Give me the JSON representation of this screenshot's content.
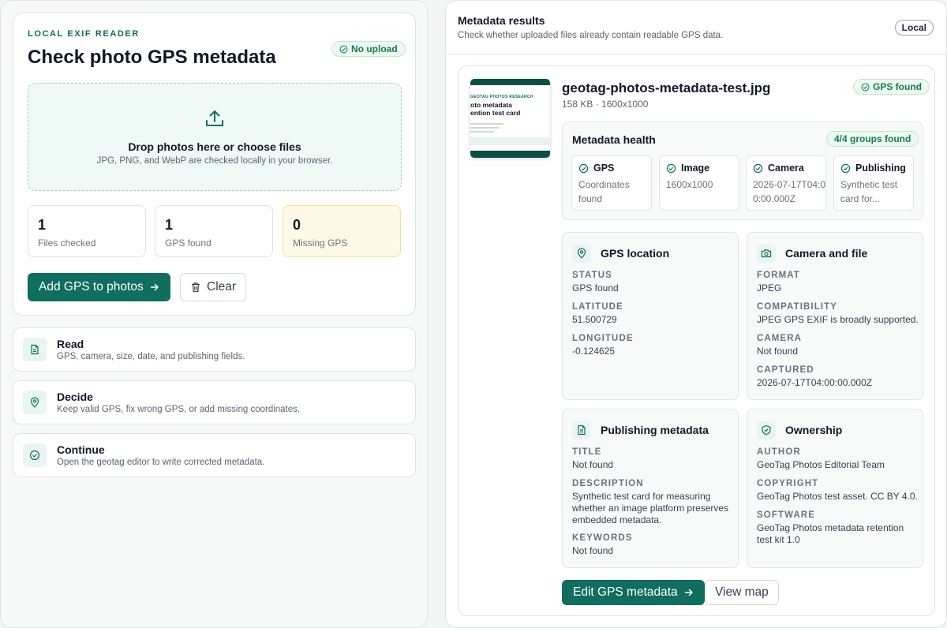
{
  "reader": {
    "eyebrow": "LOCAL EXIF READER",
    "title": "Check photo GPS metadata",
    "privacy_badge": "No upload",
    "drop_title": "Drop photos here or choose files",
    "drop_subtitle": "JPG, PNG, and WebP are checked locally in your browser.",
    "stats": [
      {
        "value": "1",
        "label": "Files checked"
      },
      {
        "value": "1",
        "label": "GPS found"
      },
      {
        "value": "0",
        "label": "Missing GPS"
      }
    ],
    "add_gps_label": "Add GPS to photos",
    "clear_label": "Clear"
  },
  "steps": [
    {
      "title": "Read",
      "desc": "GPS, camera, size, date, and publishing fields.",
      "icon": "document-icon"
    },
    {
      "title": "Decide",
      "desc": "Keep valid GPS, fix wrong GPS, or add missing coordinates.",
      "icon": "map-pin-icon"
    },
    {
      "title": "Continue",
      "desc": "Open the geotag editor to write corrected metadata.",
      "icon": "check-circle-icon"
    }
  ],
  "results": {
    "title": "Metadata results",
    "subtitle": "Check whether uploaded files already contain readable GPS data.",
    "scope_pill": "Local"
  },
  "file": {
    "name": "geotag-photos-metadata-test.jpg",
    "meta": "158 KB · 1600x1000",
    "status_badge": "GPS found",
    "thumbnail": {
      "kicker": "GEOTAG PHOTOS RESEARCH",
      "line1": "oto metadata",
      "line2": "ention test card"
    }
  },
  "health": {
    "title": "Metadata health",
    "badge": "4/4 groups found",
    "groups": [
      {
        "title": "GPS",
        "desc": "Coordinates found"
      },
      {
        "title": "Image",
        "desc": "1600x1000"
      },
      {
        "title": "Camera",
        "desc": "2026-07-17T04:00:00.000Z"
      },
      {
        "title": "Publishing",
        "desc": "Synthetic test card for..."
      }
    ]
  },
  "sections": {
    "gps": {
      "title": "GPS location",
      "fields": [
        {
          "k": "STATUS",
          "v": "GPS found"
        },
        {
          "k": "LATITUDE",
          "v": "51.500729"
        },
        {
          "k": "LONGITUDE",
          "v": "-0.124625"
        }
      ]
    },
    "camera": {
      "title": "Camera and file",
      "fields": [
        {
          "k": "FORMAT",
          "v": "JPEG"
        },
        {
          "k": "COMPATIBILITY",
          "v": "JPEG GPS EXIF is broadly supported."
        },
        {
          "k": "CAMERA",
          "v": "Not found"
        },
        {
          "k": "CAPTURED",
          "v": "2026-07-17T04:00:00.000Z"
        }
      ]
    },
    "publishing": {
      "title": "Publishing metadata",
      "fields": [
        {
          "k": "TITLE",
          "v": "Not found"
        },
        {
          "k": "DESCRIPTION",
          "v": "Synthetic test card for measuring whether an image platform preserves embedded metadata."
        },
        {
          "k": "KEYWORDS",
          "v": "Not found"
        }
      ]
    },
    "ownership": {
      "title": "Ownership",
      "fields": [
        {
          "k": "AUTHOR",
          "v": "GeoTag Photos Editorial Team"
        },
        {
          "k": "COPYRIGHT",
          "v": "GeoTag Photos test asset. CC BY 4.0."
        },
        {
          "k": "SOFTWARE",
          "v": "GeoTag Photos metadata retention test kit 1.0"
        }
      ]
    }
  },
  "actions": {
    "edit_label": "Edit GPS metadata",
    "map_label": "View map"
  },
  "colors": {
    "accent": "#0f6e5e",
    "success": "#167a53",
    "warning_bg": "#fef9e7"
  }
}
